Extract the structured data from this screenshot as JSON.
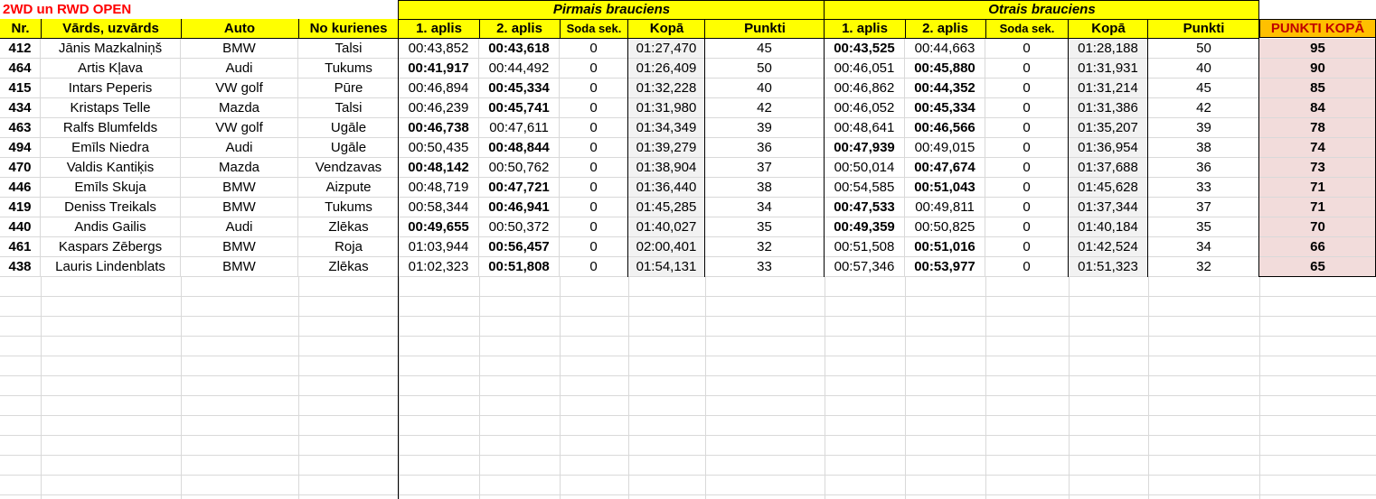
{
  "sheet": {
    "title": "2WD un RWD OPEN",
    "group1_title": "Pirmais brauciens",
    "group2_title": "Otrais brauciens",
    "headers": [
      "Nr.",
      "Vārds, uzvārds",
      "Auto",
      "No kurienes",
      "1. aplis",
      "2. aplis",
      "Soda sek.",
      "Kopā",
      "Punkti",
      "1. aplis",
      "2. aplis",
      "Soda sek.",
      "Kopā",
      "Punkti",
      "PUNKTI KOPĀ"
    ],
    "rows": [
      [
        "412",
        "Jānis Mazkalniņš",
        "BMW",
        "Talsi",
        "00:43,852",
        "00:43,618",
        "0",
        "01:27,470",
        "45",
        "00:43,525",
        "00:44,663",
        "0",
        "01:28,188",
        "50",
        "95"
      ],
      [
        "464",
        "Artis Kļava",
        "Audi",
        "Tukums",
        "00:41,917",
        "00:44,492",
        "0",
        "01:26,409",
        "50",
        "00:46,051",
        "00:45,880",
        "0",
        "01:31,931",
        "40",
        "90"
      ],
      [
        "415",
        "Intars Peperis",
        "VW golf",
        "Pūre",
        "00:46,894",
        "00:45,334",
        "0",
        "01:32,228",
        "40",
        "00:46,862",
        "00:44,352",
        "0",
        "01:31,214",
        "45",
        "85"
      ],
      [
        "434",
        "Kristaps Telle",
        "Mazda",
        "Talsi",
        "00:46,239",
        "00:45,741",
        "0",
        "01:31,980",
        "42",
        "00:46,052",
        "00:45,334",
        "0",
        "01:31,386",
        "42",
        "84"
      ],
      [
        "463",
        "Ralfs Blumfelds",
        "VW golf",
        "Ugāle",
        "00:46,738",
        "00:47,611",
        "0",
        "01:34,349",
        "39",
        "00:48,641",
        "00:46,566",
        "0",
        "01:35,207",
        "39",
        "78"
      ],
      [
        "494",
        "Emīls Niedra",
        "Audi",
        "Ugāle",
        "00:50,435",
        "00:48,844",
        "0",
        "01:39,279",
        "36",
        "00:47,939",
        "00:49,015",
        "0",
        "01:36,954",
        "38",
        "74"
      ],
      [
        "470",
        "Valdis Kantiķis",
        "Mazda",
        "Vendzavas",
        "00:48,142",
        "00:50,762",
        "0",
        "01:38,904",
        "37",
        "00:50,014",
        "00:47,674",
        "0",
        "01:37,688",
        "36",
        "73"
      ],
      [
        "446",
        "Emīls Skuja",
        "BMW",
        "Aizpute",
        "00:48,719",
        "00:47,721",
        "0",
        "01:36,440",
        "38",
        "00:54,585",
        "00:51,043",
        "0",
        "01:45,628",
        "33",
        "71"
      ],
      [
        "419",
        "Deniss Treikals",
        "BMW",
        "Tukums",
        "00:58,344",
        "00:46,941",
        "0",
        "01:45,285",
        "34",
        "00:47,533",
        "00:49,811",
        "0",
        "01:37,344",
        "37",
        "71"
      ],
      [
        "440",
        "Andis Gailis",
        "Audi",
        "Zlēkas",
        "00:49,655",
        "00:50,372",
        "0",
        "01:40,027",
        "35",
        "00:49,359",
        "00:50,825",
        "0",
        "01:40,184",
        "35",
        "70"
      ],
      [
        "461",
        "Kaspars Zēbergs",
        "BMW",
        "Roja",
        "01:03,944",
        "00:56,457",
        "0",
        "02:00,401",
        "32",
        "00:51,508",
        "00:51,016",
        "0",
        "01:42,524",
        "34",
        "66"
      ],
      [
        "438",
        "Lauris Lindenblats",
        "BMW",
        "Zlēkas",
        "01:02,323",
        "00:51,808",
        "0",
        "01:54,131",
        "33",
        "00:57,346",
        "00:53,977",
        "0",
        "01:51,323",
        "32",
        "65"
      ]
    ],
    "bold_best_lap": [
      [
        5,
        9
      ],
      [
        4,
        10
      ],
      [
        5,
        10
      ],
      [
        5,
        10
      ],
      [
        4,
        10
      ],
      [
        5,
        9
      ],
      [
        4,
        10
      ],
      [
        5,
        10
      ],
      [
        5,
        9
      ],
      [
        4,
        9
      ],
      [
        5,
        10
      ],
      [
        5,
        10
      ]
    ]
  },
  "colors": {
    "title": "#ff0000",
    "header_fill": "#ffff00",
    "total_header_fill": "#ffc000",
    "total_header_text": "#c00000",
    "total_cell_fill": "#f2dcdb",
    "gridline": "#d9d9d9"
  }
}
